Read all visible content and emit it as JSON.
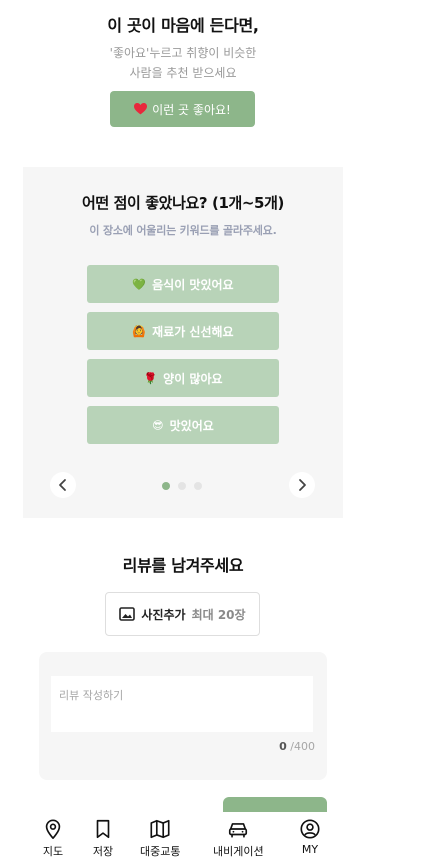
{
  "like_section": {
    "title": "이 곳이 마음에 든다면,",
    "subtitle_line1": "'좋아요'누르고 취향이 비슷한",
    "subtitle_line2": "사람을 추천 받으세요",
    "like_button_label": "이런 곳 좋아요!",
    "like_button_icon": "heart-icon",
    "accent_color": "#8db68a"
  },
  "keyword_section": {
    "title": "어떤 점이 좋았나요? (1개~5개)",
    "subtitle": "이 장소에 어울리는 키워드를 골라주세요.",
    "keywords": [
      {
        "emoji": "💚",
        "icon": "green-heart-icon",
        "label": "음식이 맛있어요"
      },
      {
        "emoji": "🙆",
        "icon": "person-gesturing-ok-icon",
        "label": "재료가 신선해요"
      },
      {
        "emoji": "🌹",
        "icon": "rose-icon",
        "label": "양이 많아요"
      },
      {
        "emoji": "😎",
        "icon": "sunglasses-face-icon",
        "label": "맛있어요"
      }
    ],
    "page_count": 3,
    "current_page": 1,
    "button_color": "#b8d3b8"
  },
  "review_section": {
    "title": "리뷰를 남겨주세요",
    "photo_button_label": "사진추가",
    "photo_button_limit": "최대 20장",
    "placeholder": "리뷰 작성하기",
    "char_count": "0",
    "char_max": "/400"
  },
  "bottom_nav": {
    "items": [
      {
        "label": "지도",
        "icon": "map-pin-icon"
      },
      {
        "label": "저장",
        "icon": "bookmark-icon"
      },
      {
        "label": "대중교통",
        "icon": "map-icon"
      },
      {
        "label": "내비게이션",
        "icon": "car-icon"
      },
      {
        "label": "MY",
        "icon": "user-icon"
      }
    ]
  }
}
